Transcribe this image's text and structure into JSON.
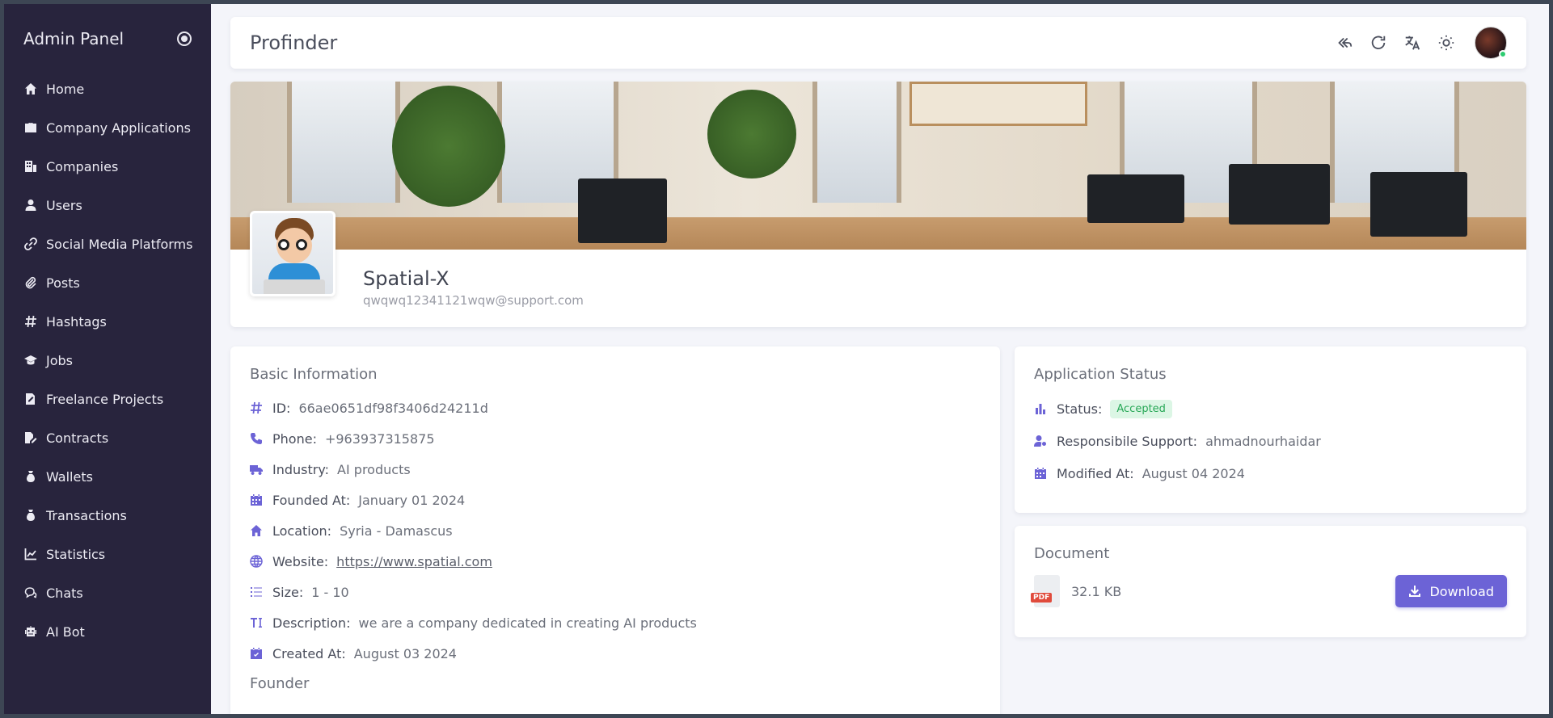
{
  "sidebar": {
    "brand": "Admin Panel",
    "items": [
      {
        "label": "Home",
        "icon": "home-icon"
      },
      {
        "label": "Company Applications",
        "icon": "briefcase-icon"
      },
      {
        "label": "Companies",
        "icon": "building-icon"
      },
      {
        "label": "Users",
        "icon": "user-icon"
      },
      {
        "label": "Social Media Platforms",
        "icon": "link-icon"
      },
      {
        "label": "Posts",
        "icon": "paperclip-icon"
      },
      {
        "label": "Hashtags",
        "icon": "hashtag-icon"
      },
      {
        "label": "Jobs",
        "icon": "graduation-cap-icon"
      },
      {
        "label": "Freelance Projects",
        "icon": "file-pen-icon"
      },
      {
        "label": "Contracts",
        "icon": "file-signature-icon"
      },
      {
        "label": "Wallets",
        "icon": "money-bag-icon"
      },
      {
        "label": "Transactions",
        "icon": "money-bag-icon"
      },
      {
        "label": "Statistics",
        "icon": "chart-line-icon"
      },
      {
        "label": "Chats",
        "icon": "comments-icon"
      },
      {
        "label": "AI Bot",
        "icon": "robot-icon"
      }
    ]
  },
  "topbar": {
    "title": "Profinder"
  },
  "profile": {
    "name": "Spatial-X",
    "email": "qwqwq12341121wqw@support.com"
  },
  "basic_info": {
    "title": "Basic Information",
    "rows": [
      {
        "label": "ID:",
        "value": "66ae0651df98f3406d24211d",
        "icon": "hashtag-icon"
      },
      {
        "label": "Phone:",
        "value": "+963937315875",
        "icon": "phone-icon"
      },
      {
        "label": "Industry:",
        "value": "AI products",
        "icon": "truck-icon"
      },
      {
        "label": "Founded At:",
        "value": "January 01 2024",
        "icon": "calendar-icon"
      },
      {
        "label": "Location:",
        "value": "Syria - Damascus",
        "icon": "home-icon"
      },
      {
        "label": "Website:",
        "value": "https://www.spatial.com",
        "icon": "globe-icon"
      },
      {
        "label": "Size:",
        "value": "1 - 10",
        "icon": "list-icon"
      },
      {
        "label": "Description:",
        "value": "we are a company dedicated in creating AI products",
        "icon": "text-height-icon"
      },
      {
        "label": "Created At:",
        "value": "August 03 2024",
        "icon": "calendar-check-icon"
      }
    ],
    "founder_title": "Founder"
  },
  "application_status": {
    "title": "Application Status",
    "status_label": "Status:",
    "status_value": "Accepted",
    "support_label": "Responsibile Support:",
    "support_value": "ahmadnourhaidar",
    "modified_label": "Modified At:",
    "modified_value": "August 04 2024"
  },
  "document": {
    "title": "Document",
    "size": "32.1 KB",
    "file_type": "PDF",
    "download_label": "Download"
  },
  "colors": {
    "sidebar_bg": "#28243d",
    "accent": "#6c63d6",
    "status_success": "#28a857"
  }
}
